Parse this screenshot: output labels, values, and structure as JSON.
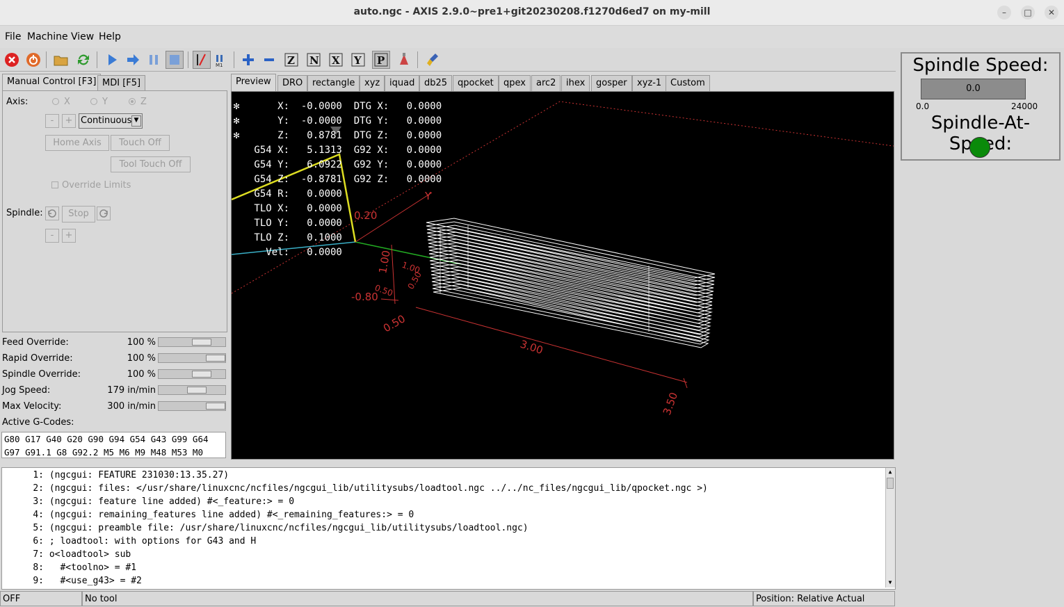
{
  "window": {
    "title": "auto.ngc - AXIS 2.9.0~pre1+git20230208.f1270d6ed7 on my-mill"
  },
  "menu": [
    "File",
    "Machine",
    "View",
    "Help"
  ],
  "toolbar": [
    "estop-icon",
    "power-icon",
    "open-file-icon",
    "reload-icon",
    "run-icon",
    "step-icon",
    "pause-icon",
    "stop-icon",
    "block-delete-icon",
    "optional-stop-icon",
    "zoom-in-icon",
    "zoom-out-icon",
    "view-z-icon",
    "view-z2-icon",
    "view-x-icon",
    "view-y-icon",
    "view-p-icon",
    "toggle-rotation-icon",
    "clear-plot-icon"
  ],
  "left_tabs": [
    "Manual Control [F3]",
    "MDI [F5]"
  ],
  "manual": {
    "axis_label": "Axis:",
    "axes": [
      "X",
      "Y",
      "Z"
    ],
    "jog_minus": "-",
    "jog_plus": "+",
    "jog_mode": "Continuous",
    "home_axis": "Home Axis",
    "touch_off": "Touch Off",
    "tool_touch_off": "Tool Touch Off",
    "override_limits": "Override Limits",
    "spindle_label": "Spindle:",
    "spindle_stop": "Stop",
    "spindle_minus": "-",
    "spindle_plus": "+"
  },
  "overrides": [
    {
      "label": "Feed Override:",
      "value": "100 %",
      "fraction": 0.7
    },
    {
      "label": "Rapid Override:",
      "value": "100 %",
      "fraction": 1.0
    },
    {
      "label": "Spindle Override:",
      "value": "100 %",
      "fraction": 0.7
    },
    {
      "label": "Jog Speed:",
      "value": "179 in/min",
      "fraction": 0.6
    },
    {
      "label": "Max Velocity:",
      "value": "300 in/min",
      "fraction": 1.0
    }
  ],
  "gcodes": {
    "label": "Active G-Codes:",
    "lines": [
      "G80 G17 G40 G20 G90 G94 G54 G43 G99 G64",
      "G97 G91.1 G8 G92.2 M5 M6 M9 M48 M53 M0"
    ]
  },
  "preview_tabs": [
    "Preview",
    "DRO",
    "rectangle",
    "xyz",
    "iquad",
    "db25",
    "qpocket",
    "qpex",
    "arc2",
    "ihex",
    "gosper",
    "xyz-1",
    "Custom"
  ],
  "dro": [
    "     X:  -0.0000  DTG X:   0.0000",
    "     Y:  -0.0000  DTG Y:   0.0000",
    "     Z:   0.8781  DTG Z:   0.0000",
    " G54 X:   5.1313  G92 X:   0.0000",
    " G54 Y:   6.0922  G92 Y:   0.0000",
    " G54 Z:  -0.8781  G92 Z:   0.0000",
    " G54 R:   0.0000",
    " TLO X:   0.0000",
    " TLO Y:   0.0000",
    " TLO Z:   0.1000",
    "   Vel:   0.0000"
  ],
  "plot_labels": [
    "Y",
    "0.20",
    "1.00",
    "1.00",
    "0.50",
    "0.50",
    "-0.80",
    "0.50",
    "3.00",
    "3.50"
  ],
  "pyvcp": {
    "spindle_speed_label": "Spindle Speed:",
    "speed_value": "0.0",
    "scale_min": "0.0",
    "scale_max": "24000",
    "at_speed_label": "Spindle-At-Speed:",
    "led_color": "#0a8a0a"
  },
  "console": [
    {
      "n": "1:",
      "text": "(ngcgui: FEATURE 231030:13.35.27)"
    },
    {
      "n": "2:",
      "text": "(ngcgui: files: </usr/share/linuxcnc/ncfiles/ngcgui_lib/utilitysubs/loadtool.ngc ../../nc_files/ngcgui_lib/qpocket.ngc >)"
    },
    {
      "n": "3:",
      "text": "(ngcgui: feature line added) #<_feature:> = 0"
    },
    {
      "n": "4:",
      "text": "(ngcgui: remaining_features line added) #<_remaining_features:> = 0"
    },
    {
      "n": "5:",
      "text": "(ngcgui: preamble file: /usr/share/linuxcnc/ncfiles/ngcgui_lib/utilitysubs/loadtool.ngc)"
    },
    {
      "n": "6:",
      "text": "; loadtool: with options for G43 and H"
    },
    {
      "n": "7:",
      "text": "o<loadtool> sub"
    },
    {
      "n": "8:",
      "text": "  #<toolno> = #1"
    },
    {
      "n": "9:",
      "text": "  #<use_g43> = #2"
    }
  ],
  "status": {
    "state": "OFF",
    "tool": "No tool",
    "position": "Position: Relative Actual"
  }
}
